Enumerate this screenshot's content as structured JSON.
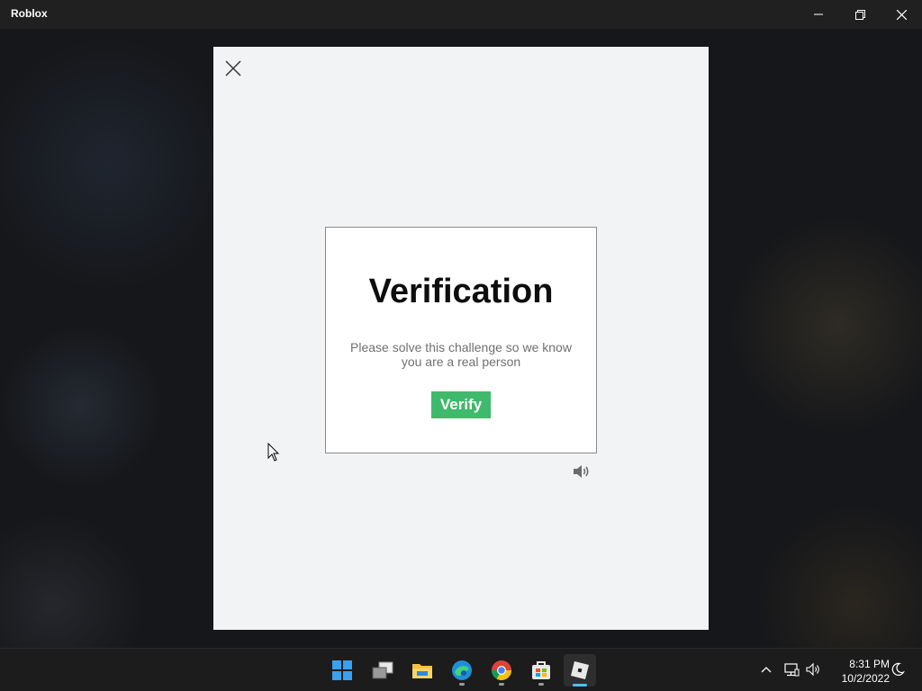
{
  "window": {
    "title": "Roblox",
    "controls": {
      "minimize": "minimize-icon",
      "maximize": "restore-icon",
      "close": "close-icon"
    }
  },
  "modal": {
    "close_icon": "close-icon",
    "challenge": {
      "heading": "Verification",
      "description_line1": "Please solve this challenge so we know",
      "description_line2": "you are a real person",
      "verify_label": "Verify",
      "audio_icon": "speaker-icon"
    }
  },
  "taskbar": {
    "apps": [
      {
        "name": "Start",
        "icon": "windows-start-icon"
      },
      {
        "name": "Task View",
        "icon": "task-view-icon"
      },
      {
        "name": "File Explorer",
        "icon": "folder-icon"
      },
      {
        "name": "Microsoft Edge",
        "icon": "edge-icon"
      },
      {
        "name": "Google Chrome",
        "icon": "chrome-icon"
      },
      {
        "name": "Microsoft Store",
        "icon": "store-icon"
      },
      {
        "name": "Roblox",
        "icon": "roblox-icon"
      }
    ],
    "tray": {
      "icons": [
        "chevron-up-icon",
        "network-icon",
        "volume-icon",
        "focus-assist-icon"
      ],
      "time": "8:31 PM",
      "date": "10/2/2022"
    }
  },
  "colors": {
    "verify_green": "#3fb96b",
    "modal_bg": "#f2f3f4",
    "taskbar_bg": "#1c1c1c",
    "active_indicator": "#4cc2ff"
  }
}
